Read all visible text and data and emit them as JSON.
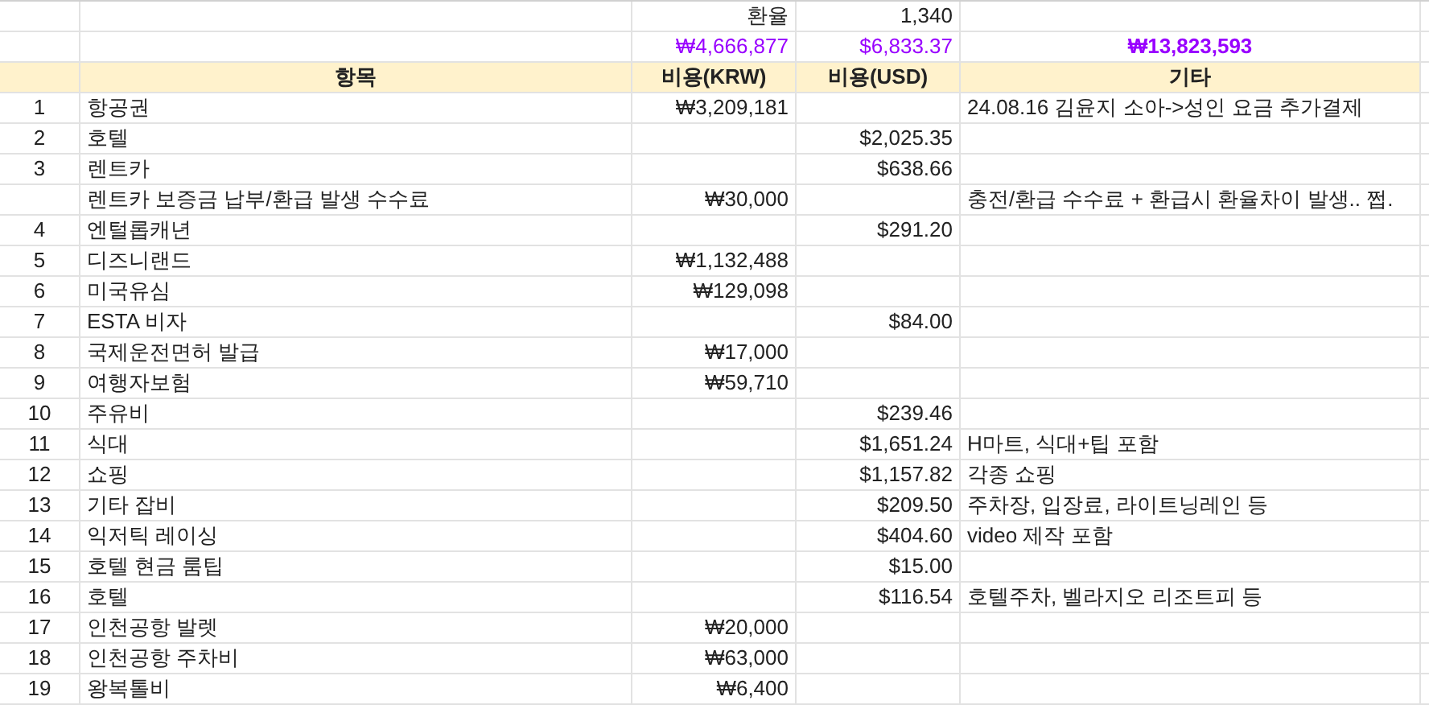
{
  "exchange_rate": {
    "label": "환율",
    "value": "1,340"
  },
  "totals": {
    "krw": "₩4,666,877",
    "usd": "$6,833.37",
    "grand": "₩13,823,593"
  },
  "columns": [
    "항목",
    "비용(KRW)",
    "비용(USD)",
    "기타"
  ],
  "rows": [
    {
      "no": "1",
      "item": "항공권",
      "krw": "₩3,209,181",
      "note": "24.08.16 김윤지 소아->성인 요금 추가결제"
    },
    {
      "no": "2",
      "item": "호텔",
      "usd": "$2,025.35"
    },
    {
      "no": "3",
      "item": "렌트카",
      "usd": "$638.66"
    },
    {
      "item": "렌트카 보증금 납부/환급 발생 수수료",
      "krw": "₩30,000",
      "note": "충전/환급 수수료 + 환급시 환율차이 발생.. 쩝."
    },
    {
      "no": "4",
      "item": "엔털롭캐년",
      "usd": "$291.20"
    },
    {
      "no": "5",
      "item": "디즈니랜드",
      "krw": "₩1,132,488"
    },
    {
      "no": "6",
      "item": "미국유심",
      "krw": "₩129,098"
    },
    {
      "no": "7",
      "item": "ESTA 비자",
      "usd": "$84.00"
    },
    {
      "no": "8",
      "item": "국제운전면허 발급",
      "krw": "₩17,000"
    },
    {
      "no": "9",
      "item": "여행자보험",
      "krw": "₩59,710"
    },
    {
      "no": "10",
      "item": "주유비",
      "usd": "$239.46"
    },
    {
      "no": "11",
      "item": "식대",
      "usd": "$1,651.24",
      "note": "H마트, 식대+팁 포함"
    },
    {
      "no": "12",
      "item": "쇼핑",
      "usd": "$1,157.82",
      "note": "각종 쇼핑"
    },
    {
      "no": "13",
      "item": "기타 잡비",
      "usd": "$209.50",
      "note": "주차장, 입장료, 라이트닝레인 등"
    },
    {
      "no": "14",
      "item": "익저틱 레이싱",
      "usd": "$404.60",
      "note": "video 제작 포함"
    },
    {
      "no": "15",
      "item": "호텔 현금 룸팁",
      "usd": "$15.00"
    },
    {
      "no": "16",
      "item": "호텔",
      "usd": "$116.54",
      "note": "호텔주차, 벨라지오 리조트피 등"
    },
    {
      "no": "17",
      "item": "인천공항 발렛",
      "krw": "₩20,000"
    },
    {
      "no": "18",
      "item": "인천공항 주차비",
      "krw": "₩63,000"
    },
    {
      "no": "19",
      "item": "왕복톨비",
      "krw": "₩6,400"
    }
  ]
}
